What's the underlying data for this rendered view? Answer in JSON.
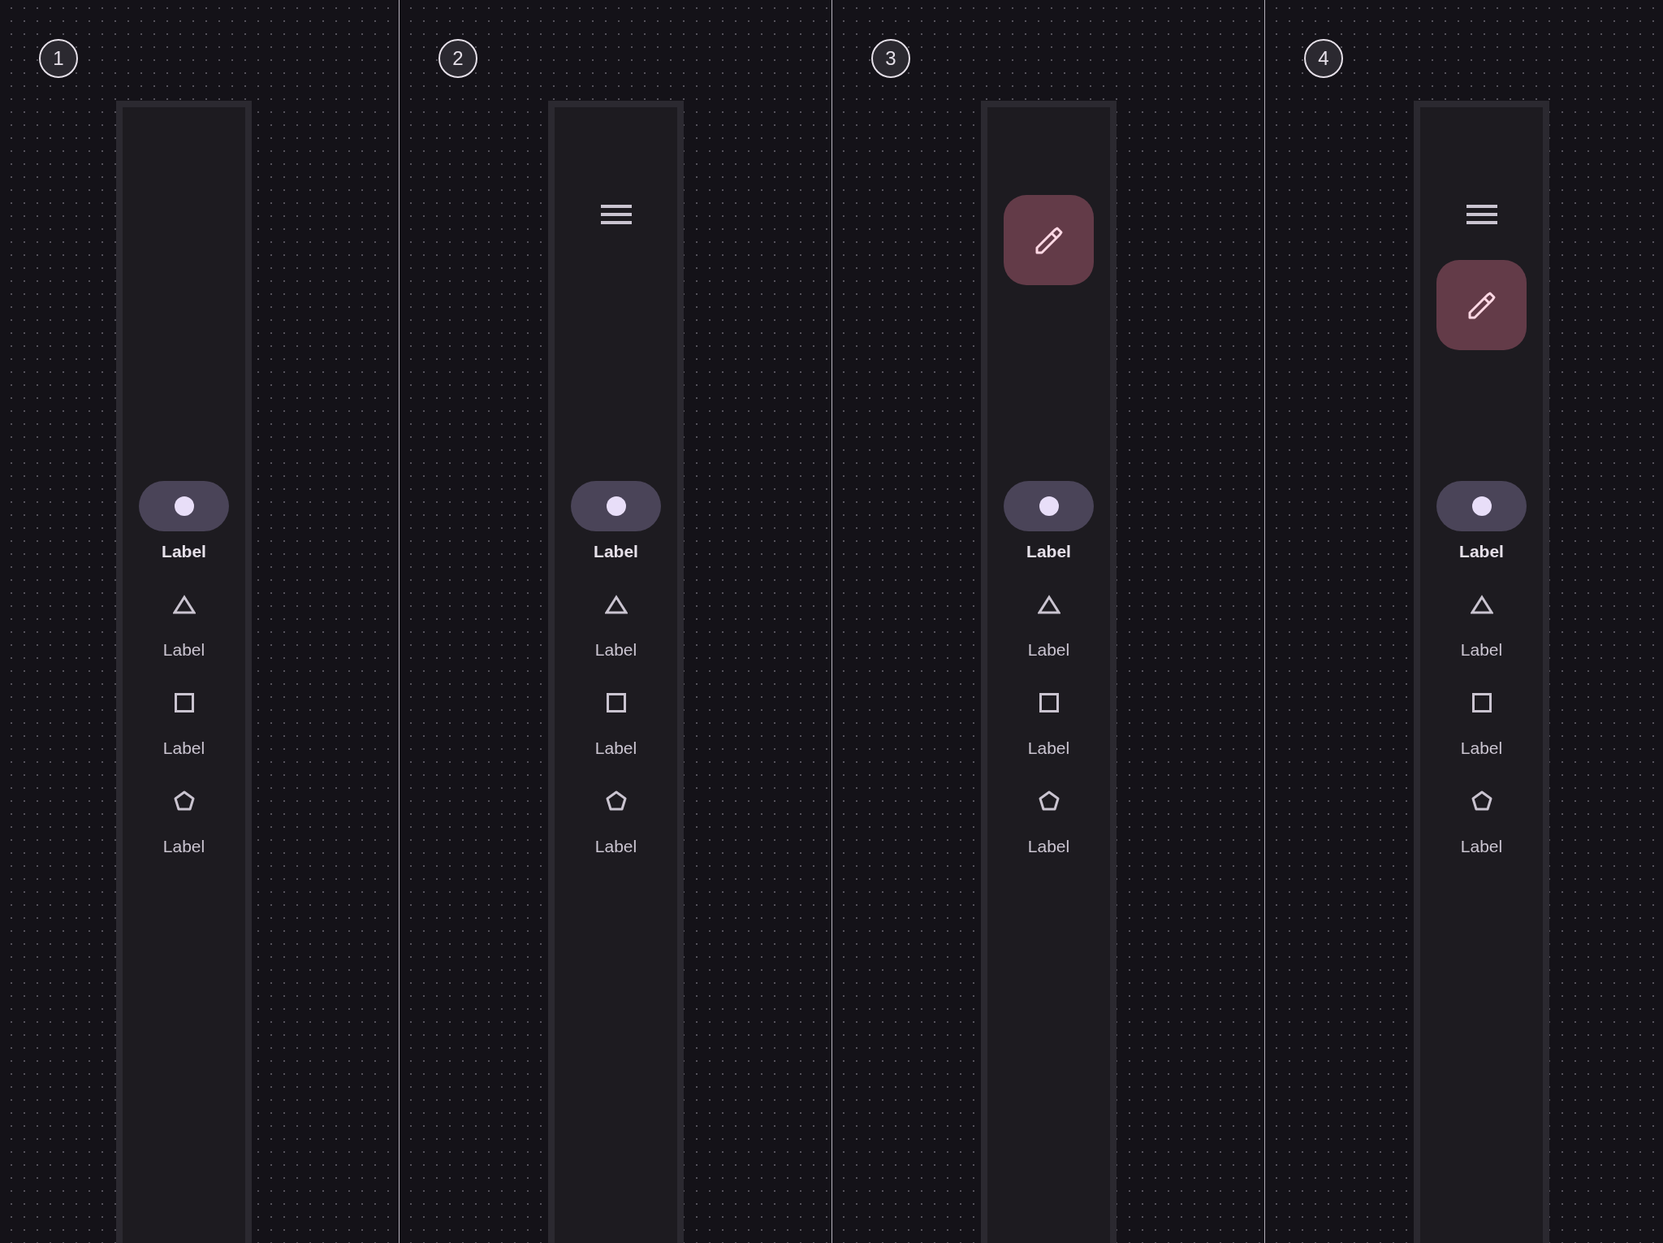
{
  "panels": [
    {
      "number": "1",
      "destinations": [
        {
          "kind": "circle",
          "label": "Label",
          "selected": true
        },
        {
          "kind": "triangle",
          "label": "Label",
          "selected": false
        },
        {
          "kind": "square",
          "label": "Label",
          "selected": false
        },
        {
          "kind": "pentagon",
          "label": "Label",
          "selected": false
        }
      ]
    },
    {
      "number": "2",
      "header_buttons": [
        {
          "kind": "menu"
        }
      ],
      "destinations": [
        {
          "kind": "circle",
          "label": "Label",
          "selected": true
        },
        {
          "kind": "triangle",
          "label": "Label",
          "selected": false
        },
        {
          "kind": "square",
          "label": "Label",
          "selected": false
        },
        {
          "kind": "pentagon",
          "label": "Label",
          "selected": false
        }
      ]
    },
    {
      "number": "3",
      "header_buttons": [
        {
          "kind": "fab"
        }
      ],
      "destinations": [
        {
          "kind": "circle",
          "label": "Label",
          "selected": true
        },
        {
          "kind": "triangle",
          "label": "Label",
          "selected": false
        },
        {
          "kind": "square",
          "label": "Label",
          "selected": false
        },
        {
          "kind": "pentagon",
          "label": "Label",
          "selected": false
        }
      ]
    },
    {
      "number": "4",
      "header_buttons": [
        {
          "kind": "menu"
        },
        {
          "kind": "fab"
        }
      ],
      "destinations": [
        {
          "kind": "circle",
          "label": "Label",
          "selected": true
        },
        {
          "kind": "triangle",
          "label": "Label",
          "selected": false
        },
        {
          "kind": "square",
          "label": "Label",
          "selected": false
        },
        {
          "kind": "pentagon",
          "label": "Label",
          "selected": false
        }
      ]
    }
  ]
}
